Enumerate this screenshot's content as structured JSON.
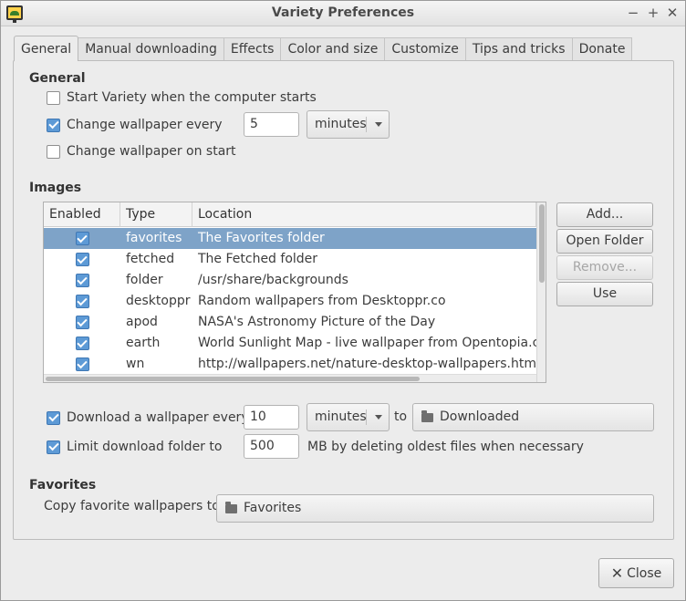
{
  "window": {
    "title": "Variety Preferences",
    "minimize": "−",
    "maximize": "+",
    "close": "✕"
  },
  "tabs": [
    "General",
    "Manual downloading",
    "Effects",
    "Color and size",
    "Customize",
    "Tips and tricks",
    "Donate"
  ],
  "general": {
    "title": "General",
    "start_on_boot": {
      "label": "Start Variety when the computer starts",
      "checked": false
    },
    "change_every": {
      "label": "Change wallpaper every",
      "checked": true,
      "value": "5",
      "unit": "minutes"
    },
    "change_on_start": {
      "label": "Change wallpaper on start",
      "checked": false
    }
  },
  "images": {
    "title": "Images",
    "columns": [
      "Enabled",
      "Type",
      "Location"
    ],
    "rows": [
      {
        "enabled": true,
        "type": "favorites",
        "location": "The Favorites folder",
        "selected": true
      },
      {
        "enabled": true,
        "type": "fetched",
        "location": "The Fetched folder",
        "selected": false
      },
      {
        "enabled": true,
        "type": "folder",
        "location": "/usr/share/backgrounds",
        "selected": false
      },
      {
        "enabled": true,
        "type": "desktoppr",
        "location": "Random wallpapers from Desktoppr.co",
        "selected": false
      },
      {
        "enabled": true,
        "type": "apod",
        "location": "NASA's Astronomy Picture of the Day",
        "selected": false
      },
      {
        "enabled": true,
        "type": "earth",
        "location": "World Sunlight Map - live wallpaper from Opentopia.com",
        "selected": false
      },
      {
        "enabled": true,
        "type": "wn",
        "location": "http://wallpapers.net/nature-desktop-wallpapers.html",
        "selected": false
      }
    ],
    "buttons": {
      "add": "Add...",
      "open_folder": "Open Folder",
      "remove": "Remove...",
      "use": "Use"
    }
  },
  "download": {
    "label": "Download a wallpaper every",
    "checked": true,
    "value": "10",
    "unit": "minutes",
    "to_label": "to",
    "folder": "Downloaded"
  },
  "limit": {
    "label": "Limit download folder to",
    "checked": true,
    "value": "500",
    "suffix": "MB by deleting oldest files when necessary"
  },
  "favorites": {
    "title": "Favorites",
    "label": "Copy favorite wallpapers to",
    "folder": "Favorites"
  },
  "footer": {
    "close_label": "Close"
  },
  "colors": {
    "selection": "#7ea3c8",
    "check": "#5d9ad6"
  }
}
